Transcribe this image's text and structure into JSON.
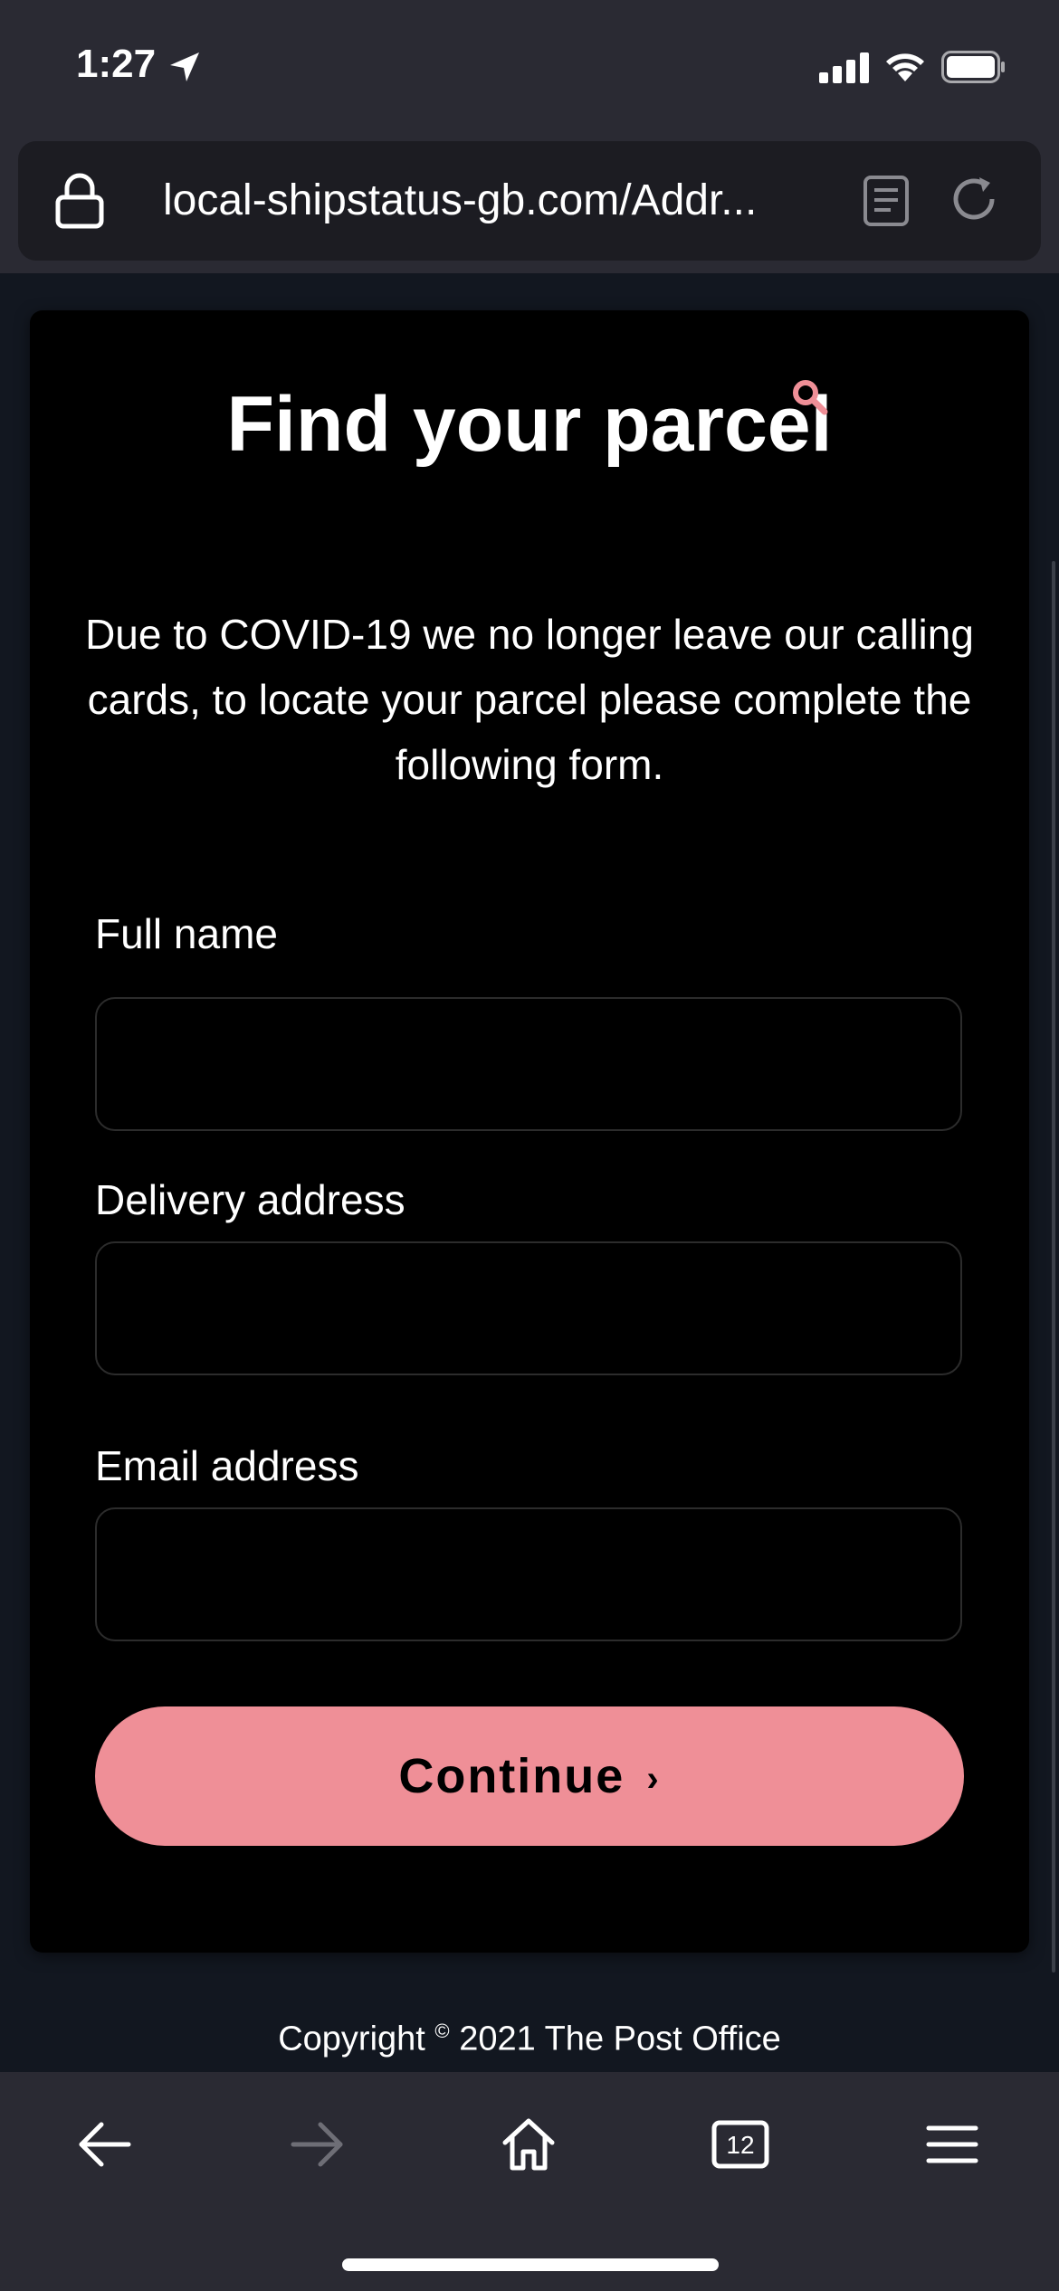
{
  "status_bar": {
    "time": "1:27"
  },
  "browser": {
    "url": "local-shipstatus-gb.com/Addr...",
    "tab_count": "12"
  },
  "page": {
    "title": "Find your parcel",
    "intro": "Due to COVID-19 we no longer leave our calling cards, to locate your parcel please complete the following form.",
    "fields": [
      {
        "label": "Full name",
        "value": "",
        "placeholder": ""
      },
      {
        "label": "Delivery address",
        "value": "",
        "placeholder": ""
      },
      {
        "label": "Email address",
        "value": "",
        "placeholder": ""
      }
    ],
    "continue_label": "Continue",
    "continue_chevron": "›",
    "copyright_prefix": "Copyright",
    "copyright_symbol": "©",
    "copyright_suffix": "2021 The Post Office"
  },
  "colors": {
    "accent": "#ef8f97",
    "card_bg": "#000000",
    "page_bg": "#121720",
    "chrome_bg": "#2a2a33"
  }
}
